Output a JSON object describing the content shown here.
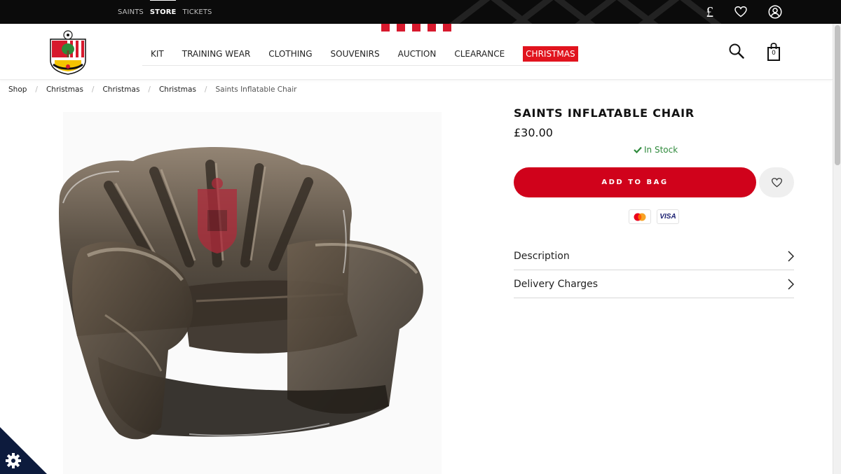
{
  "top_nav": {
    "items": [
      {
        "label": "SAINTS"
      },
      {
        "label": "STORE",
        "active": true
      },
      {
        "label": "TICKETS"
      }
    ],
    "currency_symbol": "£"
  },
  "icons": {
    "currency": "pound-icon",
    "wishlist": "heart-icon",
    "account": "user-icon",
    "search": "search-icon",
    "bag": "shopping-bag-icon",
    "settings": "gear-icon",
    "chevron": "chevron-right-icon",
    "stock": "check-icon"
  },
  "main_nav": {
    "items": [
      {
        "label": "KIT"
      },
      {
        "label": "TRAINING WEAR"
      },
      {
        "label": "CLOTHING"
      },
      {
        "label": "SOUVENIRS"
      },
      {
        "label": "AUCTION"
      },
      {
        "label": "CLEARANCE"
      },
      {
        "label": "CHRISTMAS"
      }
    ],
    "bag_count": "0"
  },
  "breadcrumb": [
    "Shop",
    "Christmas",
    "Christmas",
    "Christmas",
    "Saints Inflatable Chair"
  ],
  "product": {
    "title": "SAINTS INFLATABLE CHAIR",
    "price": "£30.00",
    "stock_status": "In Stock",
    "add_to_bag_label": "ADD TO BAG",
    "payment_methods": [
      "Mastercard",
      "VISA"
    ],
    "visa_text": "VISA",
    "accordions": [
      {
        "label": "Description"
      },
      {
        "label": "Delivery Charges"
      }
    ]
  },
  "colors": {
    "brand_red": "#d0021b",
    "christmas_red": "#e1141e",
    "top_bar": "#0b0b0b",
    "stock_green": "#2f8a3c"
  }
}
